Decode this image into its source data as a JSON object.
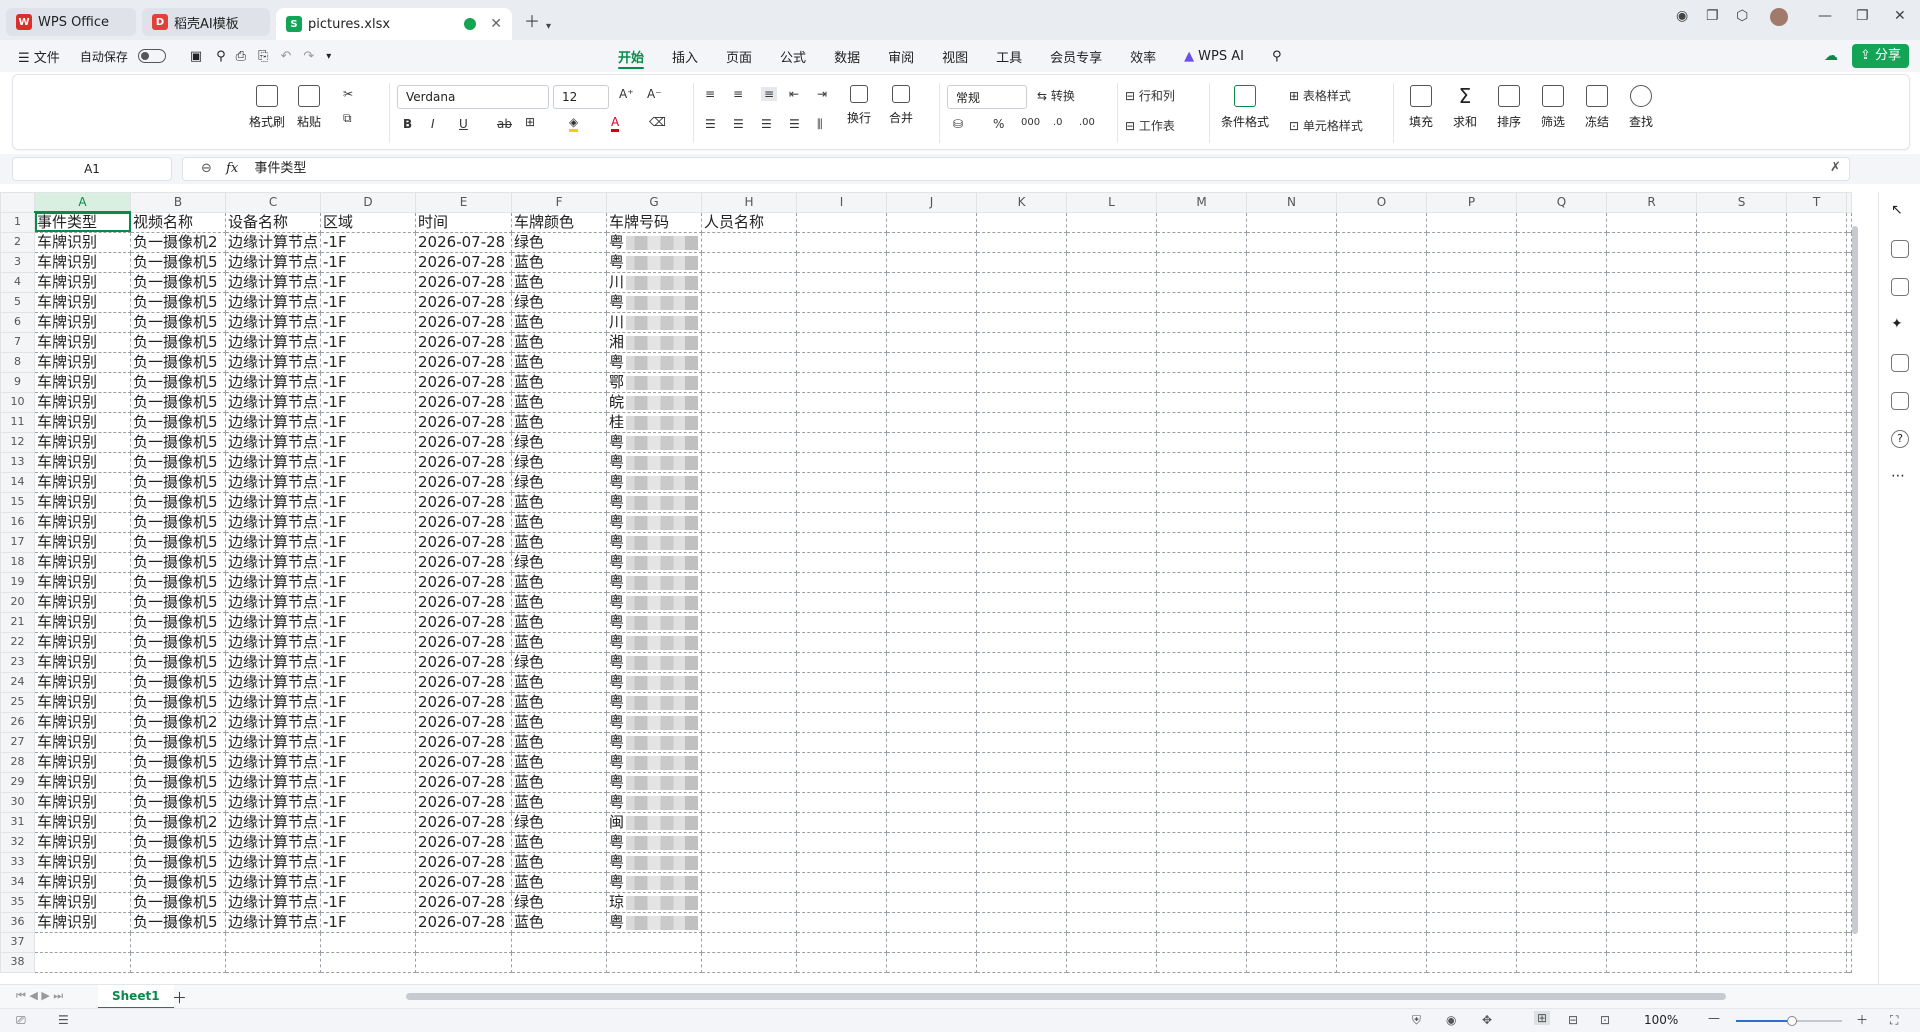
{
  "tabs": [
    {
      "label": "WPS Office",
      "color": "#d9302c",
      "icon": "wps-logo-icon"
    },
    {
      "label": "稻壳AI模板",
      "color": "#e0423b",
      "icon": "docer-icon"
    },
    {
      "label": "pictures.xlsx",
      "color": "#13a456",
      "icon": "sheet-icon"
    }
  ],
  "menu": {
    "file": "文件",
    "autosave": "自动保存",
    "tabs": [
      "开始",
      "插入",
      "页面",
      "公式",
      "数据",
      "审阅",
      "视图",
      "工具",
      "会员专享",
      "效率",
      "WPS AI"
    ],
    "share": "分享"
  },
  "ribbon": {
    "format_painter": "格式刷",
    "paste": "粘贴",
    "font_name": "Verdana",
    "font_size": "12",
    "bold": "B",
    "italic": "I",
    "underline": "U",
    "strike": "ab",
    "wrap": "换行",
    "merge": "合并",
    "number_format": "常规",
    "convert": "转换",
    "rows_cols": "行和列",
    "worksheet": "工作表",
    "percent": "%",
    "thousands": "000",
    "cond_format": "条件格式",
    "table_style": "表格样式",
    "cell_style": "单元格样式",
    "fill": "填充",
    "sum": "求和",
    "sort": "排序",
    "filter": "筛选",
    "freeze": "冻结",
    "find": "查找"
  },
  "formula": {
    "cell_ref": "A1",
    "fx": "fx",
    "content": "事件类型"
  },
  "grid": {
    "columns": [
      "A",
      "B",
      "C",
      "D",
      "E",
      "F",
      "G",
      "H",
      "I",
      "J",
      "K",
      "L",
      "M",
      "N",
      "O",
      "P",
      "Q",
      "R",
      "S",
      "T"
    ],
    "headers": [
      "事件类型",
      "视频名称",
      "设备名称",
      "区域",
      "时间",
      "车牌颜色",
      "车牌号码",
      "人员名称"
    ],
    "rows": [
      [
        "车牌识别",
        "负一摄像机2",
        "边缘计算节点",
        "-1F",
        "2026-07-28",
        "绿色",
        "粤"
      ],
      [
        "车牌识别",
        "负一摄像机5",
        "边缘计算节点",
        "-1F",
        "2026-07-28",
        "蓝色",
        "粤"
      ],
      [
        "车牌识别",
        "负一摄像机5",
        "边缘计算节点",
        "-1F",
        "2026-07-28",
        "蓝色",
        "川"
      ],
      [
        "车牌识别",
        "负一摄像机5",
        "边缘计算节点",
        "-1F",
        "2026-07-28",
        "绿色",
        "粤"
      ],
      [
        "车牌识别",
        "负一摄像机5",
        "边缘计算节点",
        "-1F",
        "2026-07-28",
        "蓝色",
        "川"
      ],
      [
        "车牌识别",
        "负一摄像机5",
        "边缘计算节点",
        "-1F",
        "2026-07-28",
        "蓝色",
        "湘"
      ],
      [
        "车牌识别",
        "负一摄像机5",
        "边缘计算节点",
        "-1F",
        "2026-07-28",
        "蓝色",
        "粤"
      ],
      [
        "车牌识别",
        "负一摄像机5",
        "边缘计算节点",
        "-1F",
        "2026-07-28",
        "蓝色",
        "鄂"
      ],
      [
        "车牌识别",
        "负一摄像机5",
        "边缘计算节点",
        "-1F",
        "2026-07-28",
        "蓝色",
        "皖"
      ],
      [
        "车牌识别",
        "负一摄像机5",
        "边缘计算节点",
        "-1F",
        "2026-07-28",
        "蓝色",
        "桂"
      ],
      [
        "车牌识别",
        "负一摄像机5",
        "边缘计算节点",
        "-1F",
        "2026-07-28",
        "绿色",
        "粤"
      ],
      [
        "车牌识别",
        "负一摄像机5",
        "边缘计算节点",
        "-1F",
        "2026-07-28",
        "绿色",
        "粤"
      ],
      [
        "车牌识别",
        "负一摄像机5",
        "边缘计算节点",
        "-1F",
        "2026-07-28",
        "绿色",
        "粤"
      ],
      [
        "车牌识别",
        "负一摄像机5",
        "边缘计算节点",
        "-1F",
        "2026-07-28",
        "蓝色",
        "粤"
      ],
      [
        "车牌识别",
        "负一摄像机5",
        "边缘计算节点",
        "-1F",
        "2026-07-28",
        "蓝色",
        "粤"
      ],
      [
        "车牌识别",
        "负一摄像机5",
        "边缘计算节点",
        "-1F",
        "2026-07-28",
        "蓝色",
        "粤"
      ],
      [
        "车牌识别",
        "负一摄像机5",
        "边缘计算节点",
        "-1F",
        "2026-07-28",
        "绿色",
        "粤"
      ],
      [
        "车牌识别",
        "负一摄像机5",
        "边缘计算节点",
        "-1F",
        "2026-07-28",
        "蓝色",
        "粤"
      ],
      [
        "车牌识别",
        "负一摄像机5",
        "边缘计算节点",
        "-1F",
        "2026-07-28",
        "蓝色",
        "粤"
      ],
      [
        "车牌识别",
        "负一摄像机5",
        "边缘计算节点",
        "-1F",
        "2026-07-28",
        "蓝色",
        "粤"
      ],
      [
        "车牌识别",
        "负一摄像机5",
        "边缘计算节点",
        "-1F",
        "2026-07-28",
        "蓝色",
        "粤"
      ],
      [
        "车牌识别",
        "负一摄像机5",
        "边缘计算节点",
        "-1F",
        "2026-07-28",
        "绿色",
        "粤"
      ],
      [
        "车牌识别",
        "负一摄像机5",
        "边缘计算节点",
        "-1F",
        "2026-07-28",
        "蓝色",
        "粤"
      ],
      [
        "车牌识别",
        "负一摄像机5",
        "边缘计算节点",
        "-1F",
        "2026-07-28",
        "蓝色",
        "粤"
      ],
      [
        "车牌识别",
        "负一摄像机2",
        "边缘计算节点",
        "-1F",
        "2026-07-28",
        "蓝色",
        "粤"
      ],
      [
        "车牌识别",
        "负一摄像机5",
        "边缘计算节点",
        "-1F",
        "2026-07-28",
        "蓝色",
        "粤"
      ],
      [
        "车牌识别",
        "负一摄像机5",
        "边缘计算节点",
        "-1F",
        "2026-07-28",
        "蓝色",
        "粤"
      ],
      [
        "车牌识别",
        "负一摄像机5",
        "边缘计算节点",
        "-1F",
        "2026-07-28",
        "蓝色",
        "粤"
      ],
      [
        "车牌识别",
        "负一摄像机5",
        "边缘计算节点",
        "-1F",
        "2026-07-28",
        "蓝色",
        "粤"
      ],
      [
        "车牌识别",
        "负一摄像机2",
        "边缘计算节点",
        "-1F",
        "2026-07-28",
        "绿色",
        "闽"
      ],
      [
        "车牌识别",
        "负一摄像机5",
        "边缘计算节点",
        "-1F",
        "2026-07-28",
        "蓝色",
        "粤"
      ],
      [
        "车牌识别",
        "负一摄像机5",
        "边缘计算节点",
        "-1F",
        "2026-07-28",
        "蓝色",
        "粤"
      ],
      [
        "车牌识别",
        "负一摄像机5",
        "边缘计算节点",
        "-1F",
        "2026-07-28",
        "蓝色",
        "粤"
      ],
      [
        "车牌识别",
        "负一摄像机5",
        "边缘计算节点",
        "-1F",
        "2026-07-28",
        "绿色",
        "琼"
      ],
      [
        "车牌识别",
        "负一摄像机5",
        "边缘计算节点",
        "-1F",
        "2026-07-28",
        "蓝色",
        "粤"
      ]
    ],
    "total_rows": 38
  },
  "sheets": {
    "active": "Sheet1"
  },
  "status": {
    "zoom": "100%"
  },
  "colors": {
    "accent": "#0a8a4a",
    "share_bg": "#13a456"
  }
}
